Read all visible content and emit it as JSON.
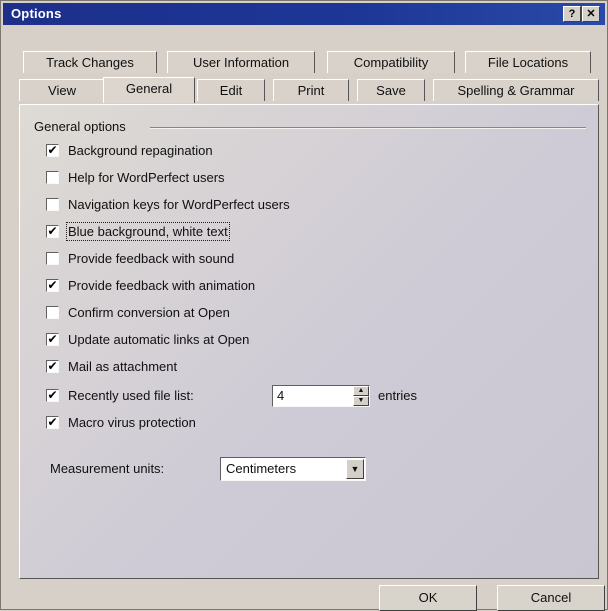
{
  "window": {
    "title": "Options",
    "help_glyph": "?",
    "close_glyph": "✕"
  },
  "tabs": {
    "row1": [
      {
        "label": "Track Changes"
      },
      {
        "label": "User Information"
      },
      {
        "label": "Compatibility"
      },
      {
        "label": "File Locations"
      }
    ],
    "row2": [
      {
        "label": "View"
      },
      {
        "label": "General",
        "active": true
      },
      {
        "label": "Edit"
      },
      {
        "label": "Print"
      },
      {
        "label": "Save"
      },
      {
        "label": "Spelling & Grammar"
      }
    ]
  },
  "general": {
    "group_label": "General options",
    "options": [
      {
        "label": "Background repagination",
        "checked": true
      },
      {
        "label": "Help for WordPerfect users",
        "checked": false
      },
      {
        "label": "Navigation keys for WordPerfect users",
        "checked": false
      },
      {
        "label": "Blue background, white text",
        "checked": true,
        "focused": true
      },
      {
        "label": "Provide feedback with sound",
        "checked": false
      },
      {
        "label": "Provide feedback with animation",
        "checked": true
      },
      {
        "label": "Confirm conversion at Open",
        "checked": false
      },
      {
        "label": "Update automatic links at Open",
        "checked": true
      },
      {
        "label": "Mail as attachment",
        "checked": true
      },
      {
        "label": "Recently used file list:",
        "checked": true
      },
      {
        "label": "Macro virus protection",
        "checked": true
      }
    ],
    "recent_files_count": "4",
    "recent_files_suffix": "entries",
    "measurement_label": "Measurement units:",
    "measurement_value": "Centimeters"
  },
  "buttons": {
    "ok": "OK",
    "cancel": "Cancel"
  },
  "check_glyph": "✔",
  "colors": {
    "title_bar": "#1d3797",
    "dialog_face": "#d6d0c8"
  }
}
